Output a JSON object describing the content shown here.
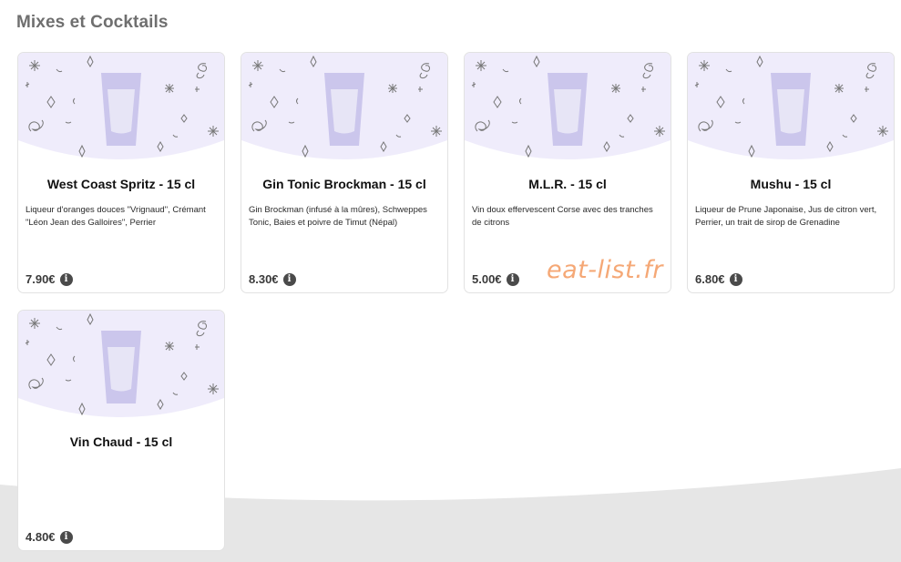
{
  "section": {
    "title": "Mixes et Cocktails"
  },
  "watermark": "eat-list.fr",
  "colors": {
    "card_illustration_bg": "#efecfb",
    "glass": "#cbc6ec",
    "page_wave": "#e6e6e6",
    "watermark": "#f5a876"
  },
  "icons": {
    "info": "info-icon",
    "illustration": "glass-illustration"
  },
  "items": [
    {
      "name": "West Coast Spritz - 15 cl",
      "description": "Liqueur d'oranges douces \"Vrignaud\", Crémant \"Léon Jean des Galloires\", Perrier",
      "price": "7.90€",
      "info_glyph": "i"
    },
    {
      "name": "Gin Tonic Brockman - 15 cl",
      "description": "Gin Brockman (infusé à la mûres), Schweppes Tonic, Baies et poivre de Timut (Népal)",
      "price": "8.30€",
      "info_glyph": "i"
    },
    {
      "name": "M.L.R. - 15 cl",
      "description": "Vin doux effervescent Corse avec des tranches de citrons",
      "price": "5.00€",
      "info_glyph": "i"
    },
    {
      "name": "Mushu - 15 cl",
      "description": "Liqueur de Prune Japonaise, Jus de citron vert, Perrier, un trait de sirop de Grenadine",
      "price": "6.80€",
      "info_glyph": "i"
    },
    {
      "name": "Vin Chaud - 15 cl",
      "description": "",
      "price": "4.80€",
      "info_glyph": "i"
    }
  ]
}
